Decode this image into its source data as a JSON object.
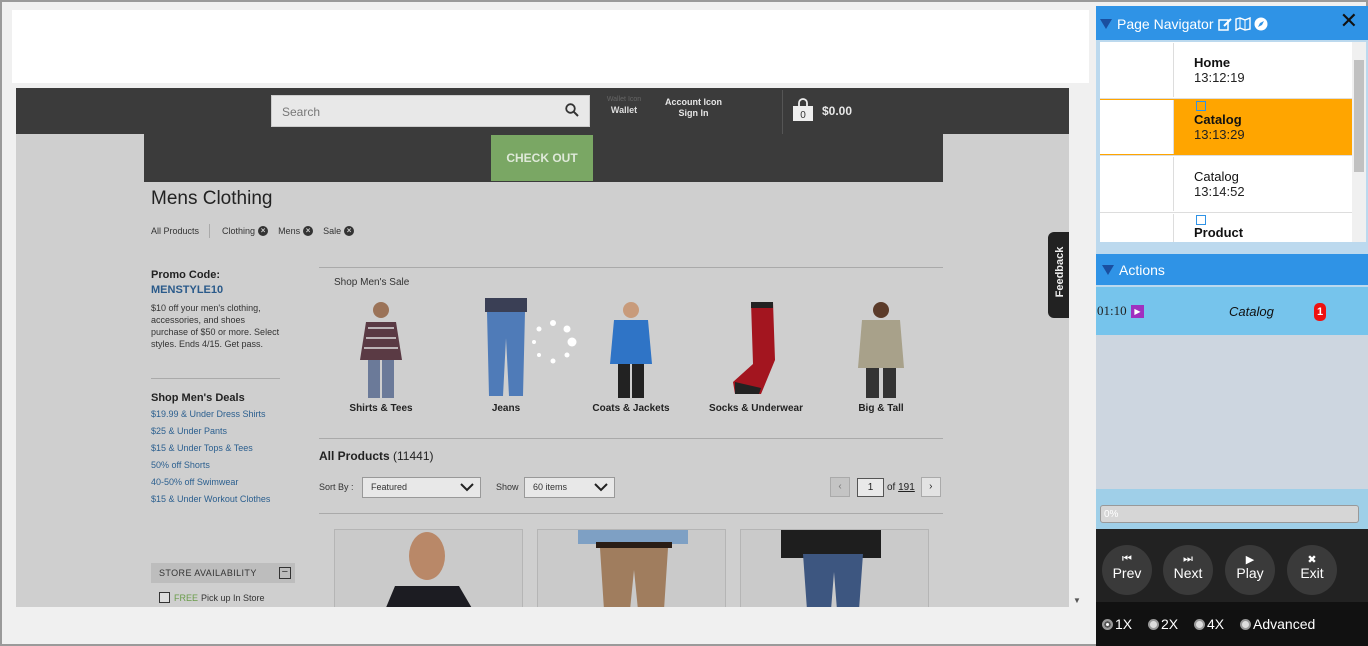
{
  "site": {
    "search_placeholder": "Search",
    "wallet_small": "Wallet Icon",
    "wallet_label": "Wallet",
    "account_line1": "Account Icon",
    "account_line2": "Sign In",
    "cart_count": "0",
    "cart_total": "$0.00",
    "checkout_label": "CHECK OUT",
    "page_title": "Mens Clothing",
    "breadcrumbs": [
      "All Products",
      "Clothing",
      "Mens",
      "Sale"
    ],
    "feedback_label": "Feedback"
  },
  "promo": {
    "heading": "Promo Code:",
    "code": "MENSTYLE10",
    "text": "$10 off your men's clothing, accessories, and shoes purchase of $50 or more. Select styles. Ends 4/15. Get pass."
  },
  "deals": {
    "heading": "Shop Men's Deals",
    "links": [
      "$19.99 & Under Dress Shirts",
      "$25 & Under Pants",
      "$15 & Under Tops & Tees",
      "50% off Shorts",
      "40-50% off Swimwear",
      "$15 & Under Workout Clothes"
    ]
  },
  "store": {
    "heading": "STORE AVAILABILITY",
    "free": "FREE",
    "pickup": "Pick up In Store"
  },
  "sale": {
    "heading": "Shop Men's Sale",
    "categories": [
      "Shirts & Tees",
      "Jeans",
      "Coats & Jackets",
      "Socks & Underwear",
      "Big & Tall"
    ]
  },
  "listing": {
    "title": "All Products",
    "count": "(11441)",
    "sort_label": "Sort By :",
    "sort_value": "Featured",
    "show_label": "Show",
    "show_value": "60 items",
    "page": "1",
    "of_label": "of",
    "total_pages": "191",
    "prev": "‹",
    "next": "›"
  },
  "navigator": {
    "title": "Page Navigator",
    "pages": [
      {
        "name": "Home",
        "time": "13:12:19",
        "active": false
      },
      {
        "name": "Catalog",
        "time": "13:13:29",
        "active": true
      },
      {
        "name": "Catalog",
        "time": "13:14:52",
        "active": false
      },
      {
        "name": "Product",
        "time": "",
        "active": false
      }
    ],
    "actions_title": "Actions",
    "action": {
      "time": "01:10",
      "name": "Catalog",
      "badge": "1"
    },
    "progress": "0%",
    "controls": {
      "prev": "Prev",
      "next": "Next",
      "play": "Play",
      "exit": "Exit"
    },
    "speeds": [
      "1X",
      "2X",
      "4X",
      "Advanced"
    ],
    "selected_speed": "1X"
  },
  "colors": {
    "accent": "#2f93e6",
    "active_page": "#ffa500",
    "checkout": "#7aa764",
    "link": "#2b5f8f"
  }
}
